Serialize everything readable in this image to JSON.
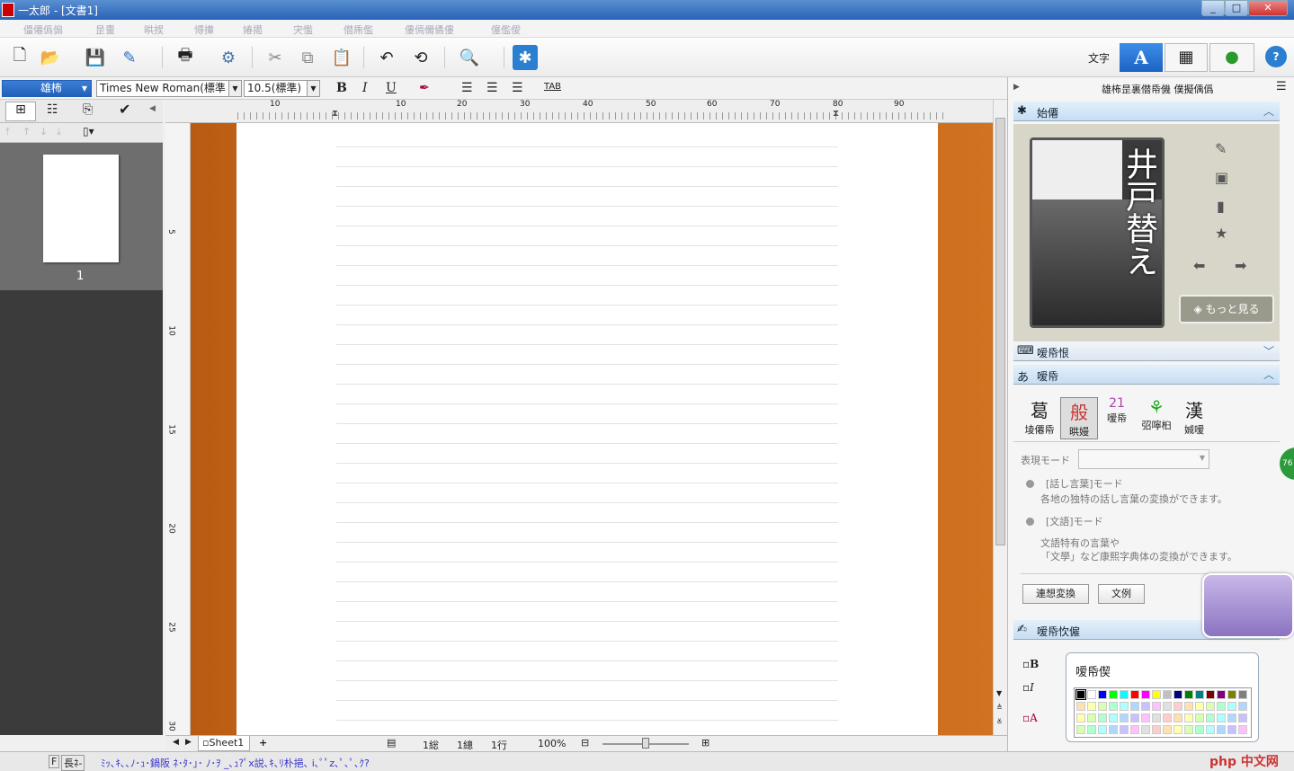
{
  "window": {
    "title": "一太郎 - [文書1]",
    "controls": [
      "_",
      "□",
      "✕"
    ]
  },
  "menu": [
    "僵僊僞傓",
    "昰夁",
    "晎捑",
    "憳撪",
    "媋擖",
    "宊懢",
    "僣乕儖",
    "僂傿儞僪僂",
    "僿儖僾"
  ],
  "toolbar": {
    "right_label": "文字",
    "help": "?"
  },
  "format": {
    "style": "雄柨",
    "font": "Times New Roman(標準",
    "size": "10.5(標準)",
    "bold": "B",
    "italic": "I",
    "underline": "U",
    "tab": "TAB"
  },
  "left_panel": {
    "page_number": "1"
  },
  "ruler": {
    "top_ticks": [
      "10",
      "10",
      "20",
      "30",
      "40",
      "50",
      "60",
      "70",
      "80",
      "90"
    ],
    "left_ticks": [
      "5",
      "10",
      "15",
      "20",
      "25",
      "30"
    ]
  },
  "doc": {
    "sheet_tab": "Sheet1",
    "add_tab": "+",
    "status_items": [
      "1総",
      "1總",
      "1行",
      "100%"
    ]
  },
  "status": {
    "f": "F",
    "mode": "長ﾈ-",
    "message": "ﾐｯ､ｷ､､ﾉ･ｭ･鍋阪 ﾈ･ﾀ･｣･ ﾉ･ｦ  _､ｭ?ﾟx説､ｷ､ﾘ朴挹､ i､ﾟﾟz､ﾟ､ﾟ､ｸ?"
  },
  "right_panel": {
    "header": "雄柨昰裏僣帋僟 僕擬偊僞",
    "section1": "始僊",
    "card_text": "井戸替え",
    "more_button": "もっと見る",
    "section2": "嗳帋恨",
    "section3": "嗳帋",
    "tools": [
      {
        "glyph": "葛",
        "label": "堎僊帋"
      },
      {
        "glyph": "般",
        "label": "晎嫚"
      },
      {
        "glyph": "21",
        "label": "嗳帋"
      },
      {
        "glyph": "⚘",
        "label": "弨嚀桕"
      },
      {
        "glyph": "漢",
        "label": "娍嗳"
      }
    ],
    "mode_label": "表現モード",
    "opt1_title": "[話し言葉]モード",
    "opt1_desc": "各地の独特の話し言葉の変換ができます。",
    "opt2_title": "[文語]モード",
    "opt2_desc1": "文語特有の言葉や",
    "opt2_desc2": "「文學」など康熙字典体の変換ができます。",
    "btn1": "連想変換",
    "btn2": "文例",
    "section4": "嗳帋忺僱",
    "palette_title": "嗳帋偰",
    "opts": [
      "B",
      "I",
      "A"
    ],
    "badge": "76"
  },
  "colors": [
    "#000000",
    "#ffffff",
    "#0000ff",
    "#00ff00",
    "#00ffff",
    "#ff0000",
    "#ff00ff",
    "#ffff00",
    "#c0c0c0",
    "#000080",
    "#008000",
    "#008080",
    "#800000",
    "#800080",
    "#808000",
    "#808080"
  ]
}
